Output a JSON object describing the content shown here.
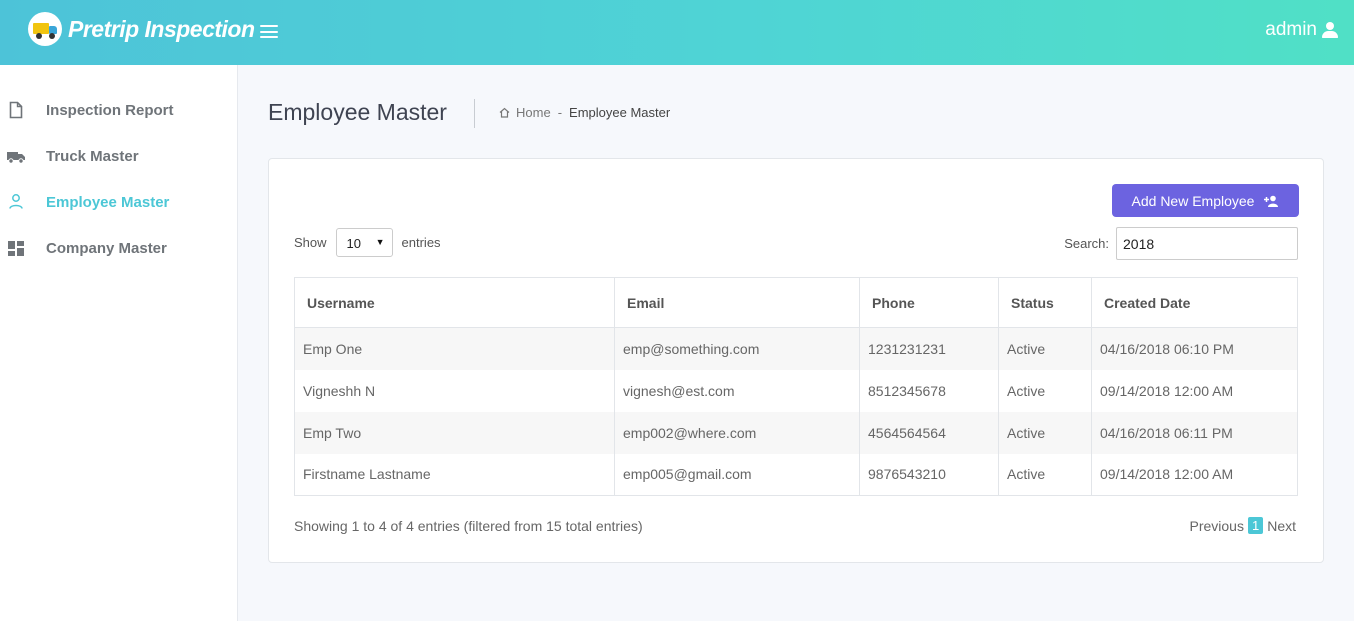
{
  "header": {
    "app_name": "Pretrip Inspection",
    "user_name": "admin",
    "colors": {
      "gradient_start": "#4dc3d8",
      "gradient_end": "#50e0c6"
    }
  },
  "sidebar": {
    "items": [
      {
        "label": "Inspection Report",
        "icon": "document-icon",
        "active": false
      },
      {
        "label": "Truck Master",
        "icon": "truck-icon",
        "active": false
      },
      {
        "label": "Employee Master",
        "icon": "user-icon",
        "active": true
      },
      {
        "label": "Company Master",
        "icon": "dashboard-icon",
        "active": false
      }
    ],
    "active_color": "#4cc7d6"
  },
  "page": {
    "title": "Employee Master",
    "breadcrumb": {
      "home": "Home",
      "separator": "-",
      "current": "Employee Master"
    }
  },
  "card": {
    "add_button_label": "Add New Employee",
    "add_button_color": "#6c63e0",
    "show_label": "Show",
    "page_size": "10",
    "entries_label": "entries",
    "search_label": "Search:",
    "search_value": "2018",
    "table": {
      "columns": [
        "Username",
        "Email",
        "Phone",
        "Status",
        "Created Date"
      ],
      "rows": [
        [
          "Emp One",
          "emp@something.com",
          "1231231231",
          "Active",
          "04/16/2018 06:10 PM"
        ],
        [
          "Vigneshh N",
          "vignesh@est.com",
          "8512345678",
          "Active",
          "09/14/2018 12:00 AM"
        ],
        [
          "Emp Two",
          "emp002@where.com",
          "4564564564",
          "Active",
          "04/16/2018 06:11 PM"
        ],
        [
          "Firstname Lastname",
          "emp005@gmail.com",
          "9876543210",
          "Active",
          "09/14/2018 12:00 AM"
        ]
      ]
    },
    "info": "Showing 1 to 4 of 4 entries (filtered from 15 total entries)",
    "pagination": {
      "previous": "Previous",
      "current": "1",
      "next": "Next"
    }
  }
}
